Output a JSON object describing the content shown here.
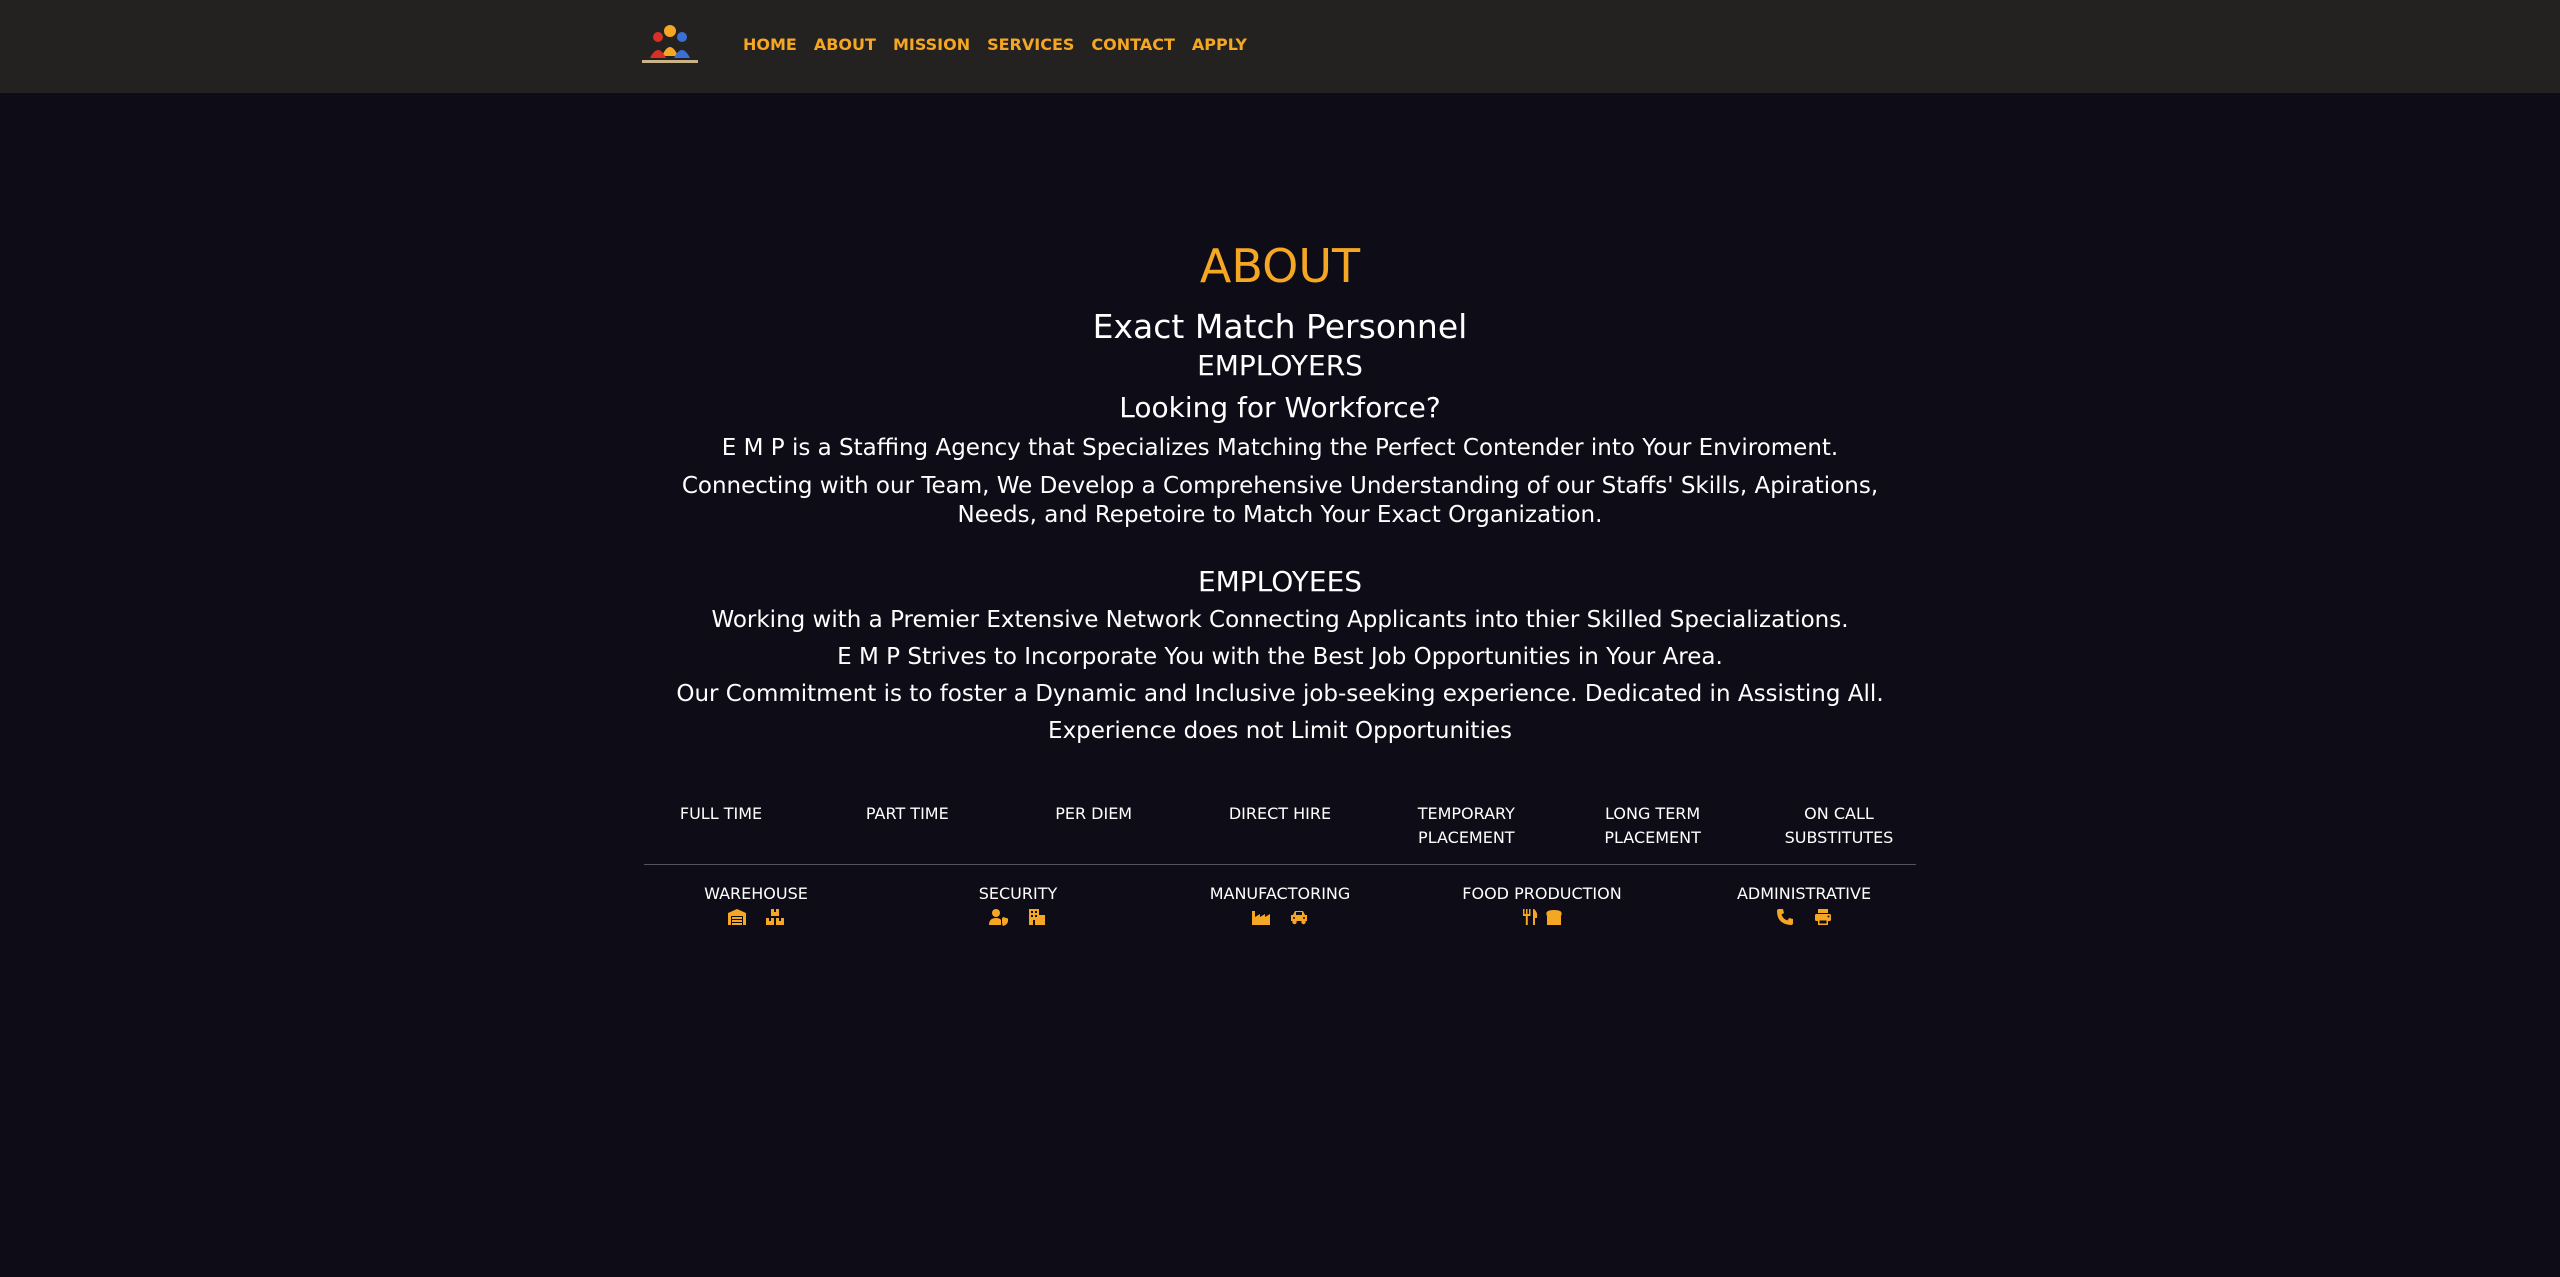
{
  "nav": {
    "logo_alt": "Exact Match Personnel",
    "links": [
      "HOME",
      "ABOUT",
      "MISSION",
      "SERVICES",
      "CONTACT",
      "APPLY"
    ]
  },
  "about": {
    "title": "ABOUT",
    "company": "Exact Match Personnel",
    "employers_heading": "EMPLOYERS",
    "employers_question": "Looking for Workforce?",
    "employers_p1": "E M P is a Staffing Agency that Specializes Matching the Perfect Contender into Your Enviroment.",
    "employers_p2": "Connecting with our Team, We Develop a Comprehensive Understanding of our Staffs' Skills, Apirations, Needs, and Repetoire to Match Your Exact Organization.",
    "employees_heading": "EMPLOYEES",
    "employees_p1": "Working with a Premier Extensive Network Connecting Applicants into thier Skilled Specializations.",
    "employees_p2": "E M P Strives to Incorporate You with the Best Job Opportunities in Your Area.",
    "employees_p3": "Our Commitment is to foster a Dynamic and Inclusive job-seeking experience. Dedicated in Assisting All.",
    "employees_p4": "Experience does not Limit Opportunities"
  },
  "employment_types": [
    "FULL TIME",
    "PART TIME",
    "PER DIEM",
    "DIRECT HIRE",
    "TEMPORARY PLACEMENT",
    "LONG TERM PLACEMENT",
    "ON CALL SUBSTITUTES"
  ],
  "categories": [
    {
      "label": "WAREHOUSE",
      "icons": [
        "warehouse-icon",
        "boxes-icon"
      ]
    },
    {
      "label": "SECURITY",
      "icons": [
        "user-shield-icon",
        "building-icon"
      ]
    },
    {
      "label": "MANUFACTORING",
      "icons": [
        "industry-icon",
        "car-icon"
      ]
    },
    {
      "label": "FOOD PRODUCTION",
      "icons": [
        "utensils-icon",
        "bread-icon"
      ]
    },
    {
      "label": "ADMINISTRATIVE",
      "icons": [
        "phone-icon",
        "print-icon"
      ]
    }
  ],
  "colors": {
    "accent": "#f5a623",
    "background": "#0e0d17",
    "navbar": "#232221",
    "text": "#ffffff"
  }
}
